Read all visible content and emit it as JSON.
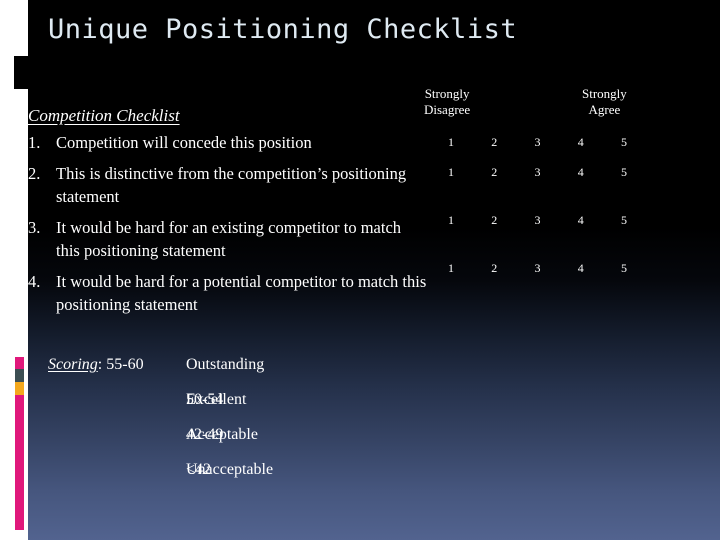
{
  "slide": {
    "title": "Unique Positioning Checklist",
    "accent_colors": {
      "magenta": "#e0187b",
      "slate": "#3c4e53",
      "orange": "#f4a81d",
      "title_text": "#dfeaf2",
      "background_bottom": "#52638f"
    }
  },
  "scale": {
    "low_label_line1": "Strongly",
    "low_label_line2": "Disagree",
    "high_label_line1": "Strongly",
    "high_label_line2": "Agree",
    "values": [
      "1",
      "2",
      "3",
      "4",
      "5"
    ]
  },
  "checklist": {
    "heading": "Competition Checklist",
    "items": [
      {
        "number": "1.",
        "text": "Competition will concede this position"
      },
      {
        "number": "2.",
        "text": "This is distinctive from the competition’s positioning statement"
      },
      {
        "number": "3.",
        "text": "It would be hard for an existing competitor to match this positioning statement"
      },
      {
        "number": "4.",
        "text": "It would be hard for a potential competitor to match this positioning statement"
      }
    ]
  },
  "scoring": {
    "label": "Scoring",
    "separator": ": ",
    "rows": [
      {
        "range": "55-60",
        "desc": "Outstanding"
      },
      {
        "range": "50-54",
        "desc": "Excellent"
      },
      {
        "range": "42-49",
        "desc": "Acceptable"
      },
      {
        "range": "<42",
        "desc": "Unacceptable"
      }
    ]
  }
}
